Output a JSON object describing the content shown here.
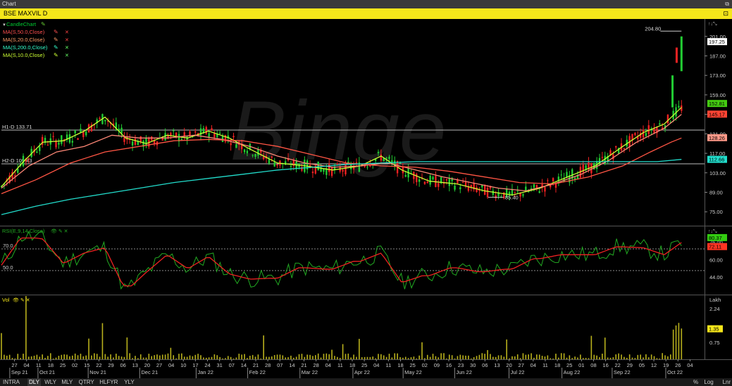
{
  "window": {
    "title": "Chart",
    "max_icon": "maximize-icon"
  },
  "header": {
    "symbol": "BSE MAXVIL D",
    "pin_icon": "pin-icon"
  },
  "watermark": "Binge",
  "legend": [
    {
      "label": "CandleChart",
      "color": "#00cc33"
    },
    {
      "label": "MA(S,50.0,Close)",
      "color": "#ff5050"
    },
    {
      "label": "MA(S,20.0,Close)",
      "color": "#ff9966"
    },
    {
      "label": "MA(S,200.0,Close)",
      "color": "#33ffcc"
    },
    {
      "label": "MA(S,10.0,Close)",
      "color": "#ccff33"
    }
  ],
  "price_axis": {
    "ticks": [
      "201.00",
      "187.00",
      "173.00",
      "159.00",
      "145.00",
      "131.00",
      "117.00",
      "103.00",
      "89.00",
      "75.00"
    ],
    "badges": [
      {
        "label": "204.80",
        "color": "#000000",
        "text_color": "#dddddd"
      },
      {
        "label": "197.25",
        "color": "#ffffff",
        "text_color": "#000000"
      },
      {
        "label": "152.81",
        "color": "#44cc11",
        "text_color": "#000000"
      },
      {
        "label": "145.17",
        "color": "#ff4433",
        "text_color": "#000000"
      },
      {
        "label": "128.26",
        "color": "#ff9988",
        "text_color": "#000000"
      },
      {
        "label": "112.66",
        "color": "#22ddcc",
        "text_color": "#000000"
      }
    ]
  },
  "hlines": [
    {
      "label": "H1-D 133.71",
      "value": 133.71
    },
    {
      "label": "H2-D 109.43",
      "value": 109.43
    }
  ],
  "low_marker": {
    "label": "85.40",
    "value": 85.4
  },
  "high_marker": {
    "label": "204.80",
    "value": 204.8
  },
  "rsi": {
    "label": "RSI(E,9,14,Close)",
    "ticks": [
      "76.00",
      "60.00",
      "44.00"
    ],
    "levels": [
      "70.0",
      "50.0"
    ],
    "badges": [
      {
        "label": "80.37",
        "color": "#33cc11"
      },
      {
        "label": "72.11",
        "color": "#ff3322"
      }
    ]
  },
  "volume": {
    "label": "Vol",
    "unit": "Lakh",
    "ticks": [
      "2.24",
      "1.35",
      "0.75"
    ],
    "badge": "1.35"
  },
  "x_axis": {
    "dates": [
      "27",
      "04",
      "11",
      "18",
      "25",
      "02",
      "15",
      "22",
      "29",
      "06",
      "13",
      "20",
      "27",
      "04",
      "10",
      "17",
      "24",
      "31",
      "07",
      "14",
      "21",
      "28",
      "07",
      "14",
      "21",
      "28",
      "04",
      "11",
      "18",
      "25",
      "04",
      "11",
      "18",
      "25",
      "02",
      "09",
      "16",
      "23",
      "30",
      "06",
      "13",
      "20",
      "27",
      "04",
      "11",
      "18",
      "25",
      "01",
      "08",
      "16",
      "22",
      "29",
      "05",
      "12",
      "19",
      "26",
      "04"
    ],
    "months": [
      {
        "label": "Sep 21",
        "pos": 0.004
      },
      {
        "label": "Oct 21",
        "pos": 0.045
      },
      {
        "label": "Nov 21",
        "pos": 0.118
      },
      {
        "label": "Dec 21",
        "pos": 0.193
      },
      {
        "label": "Jan 22",
        "pos": 0.275
      },
      {
        "label": "Feb 22",
        "pos": 0.35
      },
      {
        "label": "Mar 22",
        "pos": 0.426
      },
      {
        "label": "Apr 22",
        "pos": 0.503
      },
      {
        "label": "May 22",
        "pos": 0.576
      },
      {
        "label": "Jun 22",
        "pos": 0.651
      },
      {
        "label": "Jul 22",
        "pos": 0.73
      },
      {
        "label": "Aug 22",
        "pos": 0.807
      },
      {
        "label": "Sep 22",
        "pos": 0.88
      },
      {
        "label": "Oct 22",
        "pos": 0.958
      }
    ]
  },
  "tabs": [
    "INTRA",
    "DLY",
    "WLY",
    "MLY",
    "QTRY",
    "HLFYR",
    "YLY"
  ],
  "active_tab": "DLY",
  "tabs_right": [
    "%",
    "Log",
    "Lnr"
  ],
  "chart_data": {
    "type": "line",
    "title": "BSE MAXVIL D",
    "ylim": [
      65,
      212
    ],
    "grid": false,
    "series": [
      {
        "name": "MA(S,10.0,Close)",
        "color": "#ccff33",
        "x": [
          0,
          0.03,
          0.06,
          0.09,
          0.12,
          0.15,
          0.18,
          0.21,
          0.24,
          0.27,
          0.3,
          0.33,
          0.36,
          0.4,
          0.44,
          0.48,
          0.52,
          0.55,
          0.58,
          0.62,
          0.66,
          0.7,
          0.74,
          0.78,
          0.82,
          0.86,
          0.9,
          0.93,
          0.96,
          0.985
        ],
        "y": [
          93,
          110,
          125,
          126,
          133,
          143,
          128,
          124,
          130,
          128,
          133,
          128,
          120,
          110,
          108,
          105,
          108,
          115,
          105,
          97,
          95,
          90,
          87,
          92,
          100,
          108,
          122,
          132,
          138,
          150
        ]
      },
      {
        "name": "MA(S,20.0,Close)",
        "color": "#ff8877",
        "x": [
          0,
          0.04,
          0.08,
          0.12,
          0.16,
          0.2,
          0.24,
          0.28,
          0.32,
          0.36,
          0.4,
          0.44,
          0.48,
          0.52,
          0.56,
          0.6,
          0.64,
          0.68,
          0.72,
          0.76,
          0.8,
          0.84,
          0.88,
          0.92,
          0.96,
          0.985
        ],
        "y": [
          92,
          108,
          118,
          122,
          130,
          128,
          128,
          130,
          127,
          122,
          115,
          110,
          107,
          108,
          110,
          105,
          100,
          96,
          92,
          90,
          95,
          102,
          112,
          125,
          135,
          145
        ]
      },
      {
        "name": "MA(S,50.0,Close)",
        "color": "#ff5544",
        "x": [
          0,
          0.05,
          0.1,
          0.15,
          0.2,
          0.25,
          0.3,
          0.35,
          0.4,
          0.45,
          0.5,
          0.55,
          0.6,
          0.65,
          0.7,
          0.75,
          0.8,
          0.85,
          0.9,
          0.94,
          0.97,
          0.985
        ],
        "y": [
          88,
          98,
          110,
          118,
          122,
          126,
          127,
          126,
          122,
          116,
          110,
          108,
          107,
          104,
          100,
          96,
          95,
          100,
          108,
          118,
          125,
          128
        ]
      },
      {
        "name": "MA(S,200.0,Close)",
        "color": "#22ddcc",
        "x": [
          0,
          0.05,
          0.1,
          0.15,
          0.2,
          0.25,
          0.3,
          0.35,
          0.4,
          0.45,
          0.5,
          0.55,
          0.6,
          0.65,
          0.7,
          0.75,
          0.8,
          0.85,
          0.9,
          0.95,
          0.985
        ],
        "y": [
          73,
          79,
          84,
          88,
          92,
          96,
          99,
          102,
          105,
          107,
          109,
          110,
          111,
          111,
          111,
          111,
          111,
          111,
          111,
          111,
          112.66
        ]
      }
    ]
  }
}
